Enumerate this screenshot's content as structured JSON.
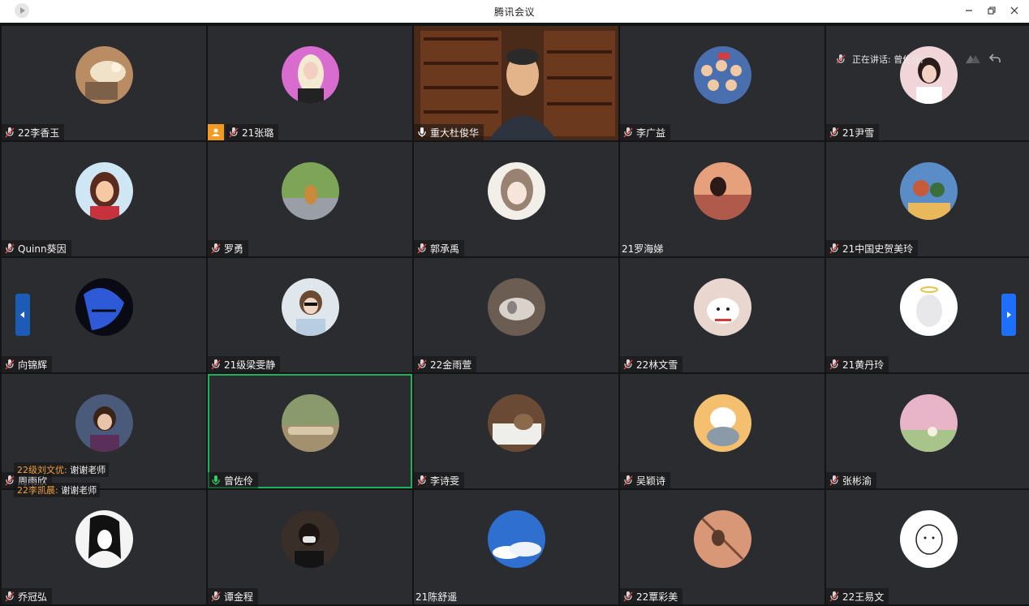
{
  "window": {
    "title": "腾讯会议",
    "left_caption": "",
    "minimize_icon": "minimize-icon",
    "restore_icon": "restore-icon",
    "close_icon": "close-icon"
  },
  "speaking": {
    "label": "正在讲话: 曾佐伶;"
  },
  "colors": {
    "accent": "#1f6fff",
    "active_border": "#1fb15a",
    "chat_name": "#f0a23c",
    "host_badge": "#f39a22"
  },
  "participants": [
    {
      "name": "22李香玉",
      "mic": "muted",
      "avatar": "avatar-cat-sleeping"
    },
    {
      "name": "21张璐",
      "mic": "muted",
      "avatar": "avatar-blonde-woman",
      "host": true
    },
    {
      "name": "重大杜俊华",
      "mic": "on",
      "avatar": "video-bookshelf-man",
      "video": true
    },
    {
      "name": "李广益",
      "mic": "muted",
      "avatar": "avatar-crowd-illustration"
    },
    {
      "name": "21尹雪",
      "mic": "muted",
      "avatar": "avatar-girl-photo"
    },
    {
      "name": "Quinn葵因",
      "mic": "muted",
      "avatar": "avatar-belle-princess"
    },
    {
      "name": "罗勇",
      "mic": "muted",
      "avatar": "avatar-cat-grass"
    },
    {
      "name": "郭承禹",
      "mic": "muted",
      "avatar": "avatar-anime-girl"
    },
    {
      "name": "21罗海娣",
      "mic": "none",
      "avatar": "avatar-sunset-person"
    },
    {
      "name": "21中国史贺美玲",
      "mic": "muted",
      "avatar": "avatar-cartoon-girls"
    },
    {
      "name": "向锦辉",
      "mic": "muted",
      "avatar": "avatar-blue-sketch"
    },
    {
      "name": "21级梁雯静",
      "mic": "muted",
      "avatar": "avatar-woman-sunglasses"
    },
    {
      "name": "22金雨萱",
      "mic": "muted",
      "avatar": "avatar-cat-lying"
    },
    {
      "name": "22林文雪",
      "mic": "muted",
      "avatar": "avatar-white-cat"
    },
    {
      "name": "21黄丹玲",
      "mic": "muted",
      "avatar": "avatar-angel-blob"
    },
    {
      "name": "周雨欣",
      "mic": "muted",
      "avatar": "avatar-cartoon-person"
    },
    {
      "name": "曾佐伶",
      "mic": "speaking",
      "avatar": "avatar-log-forest",
      "active": true
    },
    {
      "name": "李诗雯",
      "mic": "muted",
      "avatar": "avatar-cat-desk"
    },
    {
      "name": "吴颖诗",
      "mic": "muted",
      "avatar": "avatar-cartoon-pets"
    },
    {
      "name": "张彬渝",
      "mic": "muted",
      "avatar": "avatar-pink-sky"
    },
    {
      "name": "乔冠弘",
      "mic": "muted",
      "avatar": "avatar-bw-anime"
    },
    {
      "name": "谭金程",
      "mic": "muted",
      "avatar": "avatar-masked-person"
    },
    {
      "name": "21陈舒遥",
      "mic": "none",
      "avatar": "avatar-blue-clouds"
    },
    {
      "name": "22覃彩美",
      "mic": "muted",
      "avatar": "avatar-girl-swing"
    },
    {
      "name": "22王易文",
      "mic": "muted",
      "avatar": "avatar-line-dog"
    }
  ],
  "chat": [
    {
      "who": "22级刘文优:",
      "text": "谢谢老师"
    },
    {
      "who": "22李凯晨:",
      "text": "谢谢老师"
    }
  ]
}
